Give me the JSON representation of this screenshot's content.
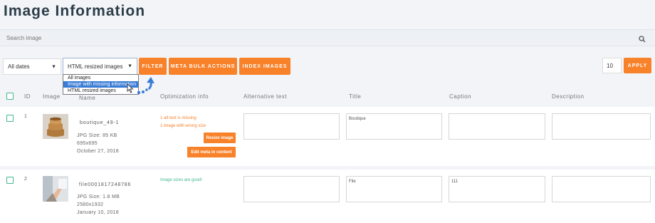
{
  "page": {
    "title": "Image Information"
  },
  "search": {
    "placeholder": "Search image"
  },
  "filters": {
    "dates_value": "All dates",
    "type_value": "HTML resized images",
    "type_options": [
      "All images",
      "Image with missing information",
      "HTML resized images"
    ],
    "filter_label": "FILTER",
    "meta_bulk_label": "META BULK ACTIONS",
    "index_label": "INDEX IMAGES",
    "per_page_value": "10",
    "apply_label": "APPLY"
  },
  "table": {
    "headers": [
      "ID",
      "Image",
      "Name",
      "Optimization info",
      "Alternative text",
      "Title",
      "Caption",
      "Description"
    ],
    "rows": [
      {
        "id": "1",
        "name": "boutique_49-1",
        "size": "JPG Size: 85 KB",
        "dimensions": "695x695",
        "date": "October 27, 2018",
        "messages": [
          "1 alt text is missing",
          "1 image with wrong size"
        ],
        "resize_label": "Resize image",
        "edit_label": "Edit meta in content",
        "alt": "",
        "title": "Boutique",
        "caption": "",
        "description": ""
      },
      {
        "id": "2",
        "name": "file0001817248786",
        "size": "JPG Size: 1.8 MB",
        "dimensions": "2580x1932",
        "date": "January 10, 2018",
        "good_message": "Image sizes are good!",
        "alt": "",
        "title": "File",
        "caption": "111",
        "description": ""
      }
    ]
  },
  "colors": {
    "accent": "#f8822a",
    "success": "#43b78f",
    "select_highlight": "#3a7bd5"
  }
}
